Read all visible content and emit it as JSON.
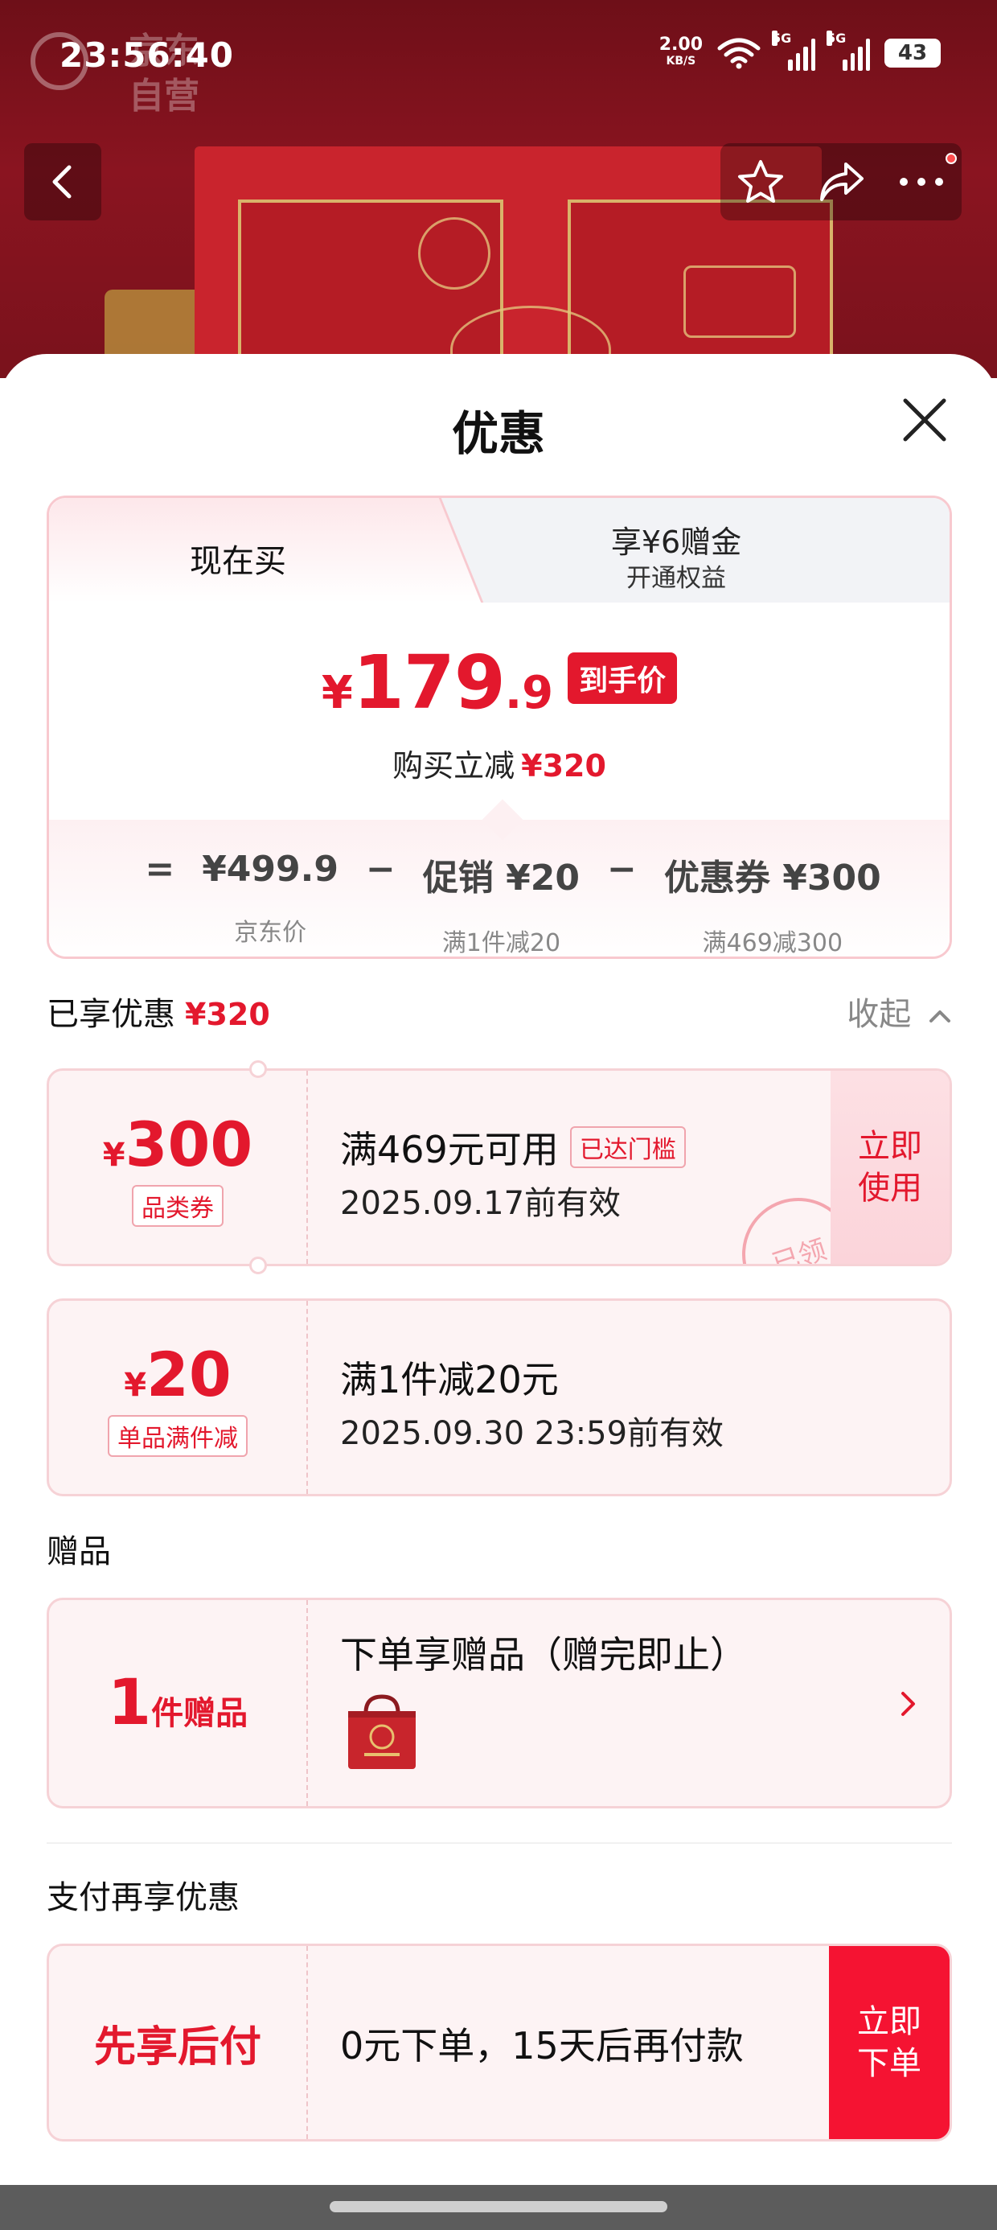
{
  "status_bar": {
    "time": "23:56:40",
    "net_speed": "2.00",
    "net_unit": "KB/S",
    "signal1": "5G",
    "signal2": "5G",
    "battery": "43"
  },
  "background": {
    "logo_text_line1": "京东",
    "logo_text_line2": "自营"
  },
  "sheet": {
    "title": "优惠"
  },
  "tabs": {
    "active_label": "现在买",
    "inactive_line1": "享¥6赠金",
    "inactive_line2": "开通权益"
  },
  "price": {
    "currency": "¥",
    "integer": "179",
    "decimal": ".9",
    "tag": "到手价",
    "save_label": "购买立减",
    "save_amount": "¥320"
  },
  "breakdown": {
    "eq": "=",
    "minus": "−",
    "items": [
      {
        "value": "¥499.9",
        "sub": "京东价"
      },
      {
        "value": "促销 ¥20",
        "sub": "满1件减20"
      },
      {
        "value": "优惠券 ¥300",
        "sub": "满469减300"
      }
    ]
  },
  "enjoyed": {
    "label": "已享优惠",
    "amount": "¥320",
    "collapse": "收起"
  },
  "coupons": [
    {
      "currency": "¥",
      "amount": "300",
      "type": "品类券",
      "title": "满469元可用",
      "reach_tag": "已达门槛",
      "validity": "2025.09.17前有效",
      "button_line1": "立即",
      "button_line2": "使用",
      "stamp": "已领"
    },
    {
      "currency": "¥",
      "amount": "20",
      "type": "单品满件减",
      "title": "满1件减20元",
      "validity": "2025.09.30 23:59前有效"
    }
  ],
  "gifts": {
    "section_label": "赠品",
    "count": "1",
    "count_unit": "件赠品",
    "title": "下单享赠品（赠完即止）"
  },
  "payment": {
    "section_label": "支付再享优惠",
    "name": "先享后付",
    "desc": "0元下单，15天后再付款",
    "button_line1": "立即",
    "button_line2": "下单"
  },
  "colors": {
    "accent": "#e3182d",
    "pay_button": "#f51332",
    "coupon_bg": "#fdf3f4"
  }
}
